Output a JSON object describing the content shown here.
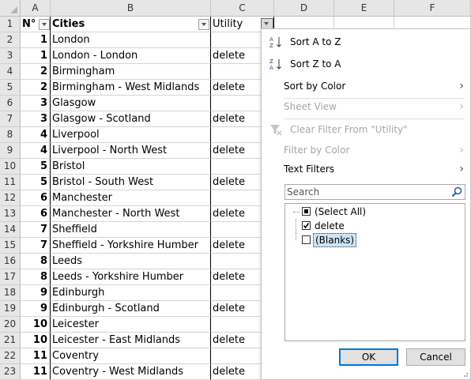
{
  "columns": [
    "A",
    "B",
    "C",
    "D",
    "E",
    "F"
  ],
  "header_row": {
    "row": "1",
    "a": "N°",
    "b": "Cities",
    "c": "Utility"
  },
  "rows": [
    {
      "row": "2",
      "num": "1",
      "city": "London",
      "util": ""
    },
    {
      "row": "3",
      "num": "1",
      "city": "London - London",
      "util": "delete"
    },
    {
      "row": "4",
      "num": "2",
      "city": "Birmingham",
      "util": ""
    },
    {
      "row": "5",
      "num": "2",
      "city": "Birmingham - West Midlands",
      "util": "delete"
    },
    {
      "row": "6",
      "num": "3",
      "city": "Glasgow",
      "util": ""
    },
    {
      "row": "7",
      "num": "3",
      "city": "Glasgow - Scotland",
      "util": "delete"
    },
    {
      "row": "8",
      "num": "4",
      "city": "Liverpool",
      "util": ""
    },
    {
      "row": "9",
      "num": "4",
      "city": "Liverpool - North West",
      "util": "delete"
    },
    {
      "row": "10",
      "num": "5",
      "city": "Bristol",
      "util": ""
    },
    {
      "row": "11",
      "num": "5",
      "city": "Bristol - South West",
      "util": "delete"
    },
    {
      "row": "12",
      "num": "6",
      "city": "Manchester",
      "util": ""
    },
    {
      "row": "13",
      "num": "6",
      "city": "Manchester - North West",
      "util": "delete"
    },
    {
      "row": "14",
      "num": "7",
      "city": "Sheffield",
      "util": ""
    },
    {
      "row": "15",
      "num": "7",
      "city": "Sheffield - Yorkshire Humber",
      "util": "delete"
    },
    {
      "row": "16",
      "num": "8",
      "city": "Leeds",
      "util": ""
    },
    {
      "row": "17",
      "num": "8",
      "city": "Leeds - Yorkshire Humber",
      "util": "delete"
    },
    {
      "row": "18",
      "num": "9",
      "city": "Edinburgh",
      "util": ""
    },
    {
      "row": "19",
      "num": "9",
      "city": "Edinburgh - Scotland",
      "util": "delete"
    },
    {
      "row": "20",
      "num": "10",
      "city": "Leicester",
      "util": ""
    },
    {
      "row": "21",
      "num": "10",
      "city": "Leicester - East Midlands",
      "util": "delete"
    },
    {
      "row": "22",
      "num": "11",
      "city": "Coventry",
      "util": ""
    },
    {
      "row": "23",
      "num": "11",
      "city": "Coventry - West Midlands",
      "util": "delete"
    }
  ],
  "menu": {
    "sort_az": "Sort A to Z",
    "sort_za": "Sort Z to A",
    "sort_by_color": "Sort by Color",
    "sheet_view": "Sheet View",
    "clear_filter": "Clear Filter From \"Utility\"",
    "filter_by_color": "Filter by Color",
    "text_filters": "Text Filters",
    "search_placeholder": "Search",
    "items": [
      {
        "label": "(Select All)",
        "state": "partial"
      },
      {
        "label": "delete",
        "state": "checked"
      },
      {
        "label": "(Blanks)",
        "state": "unchecked"
      }
    ],
    "ok": "OK",
    "cancel": "Cancel"
  },
  "colors": {
    "accent": "#0078d7",
    "header_bg": "#e6e6e6"
  }
}
